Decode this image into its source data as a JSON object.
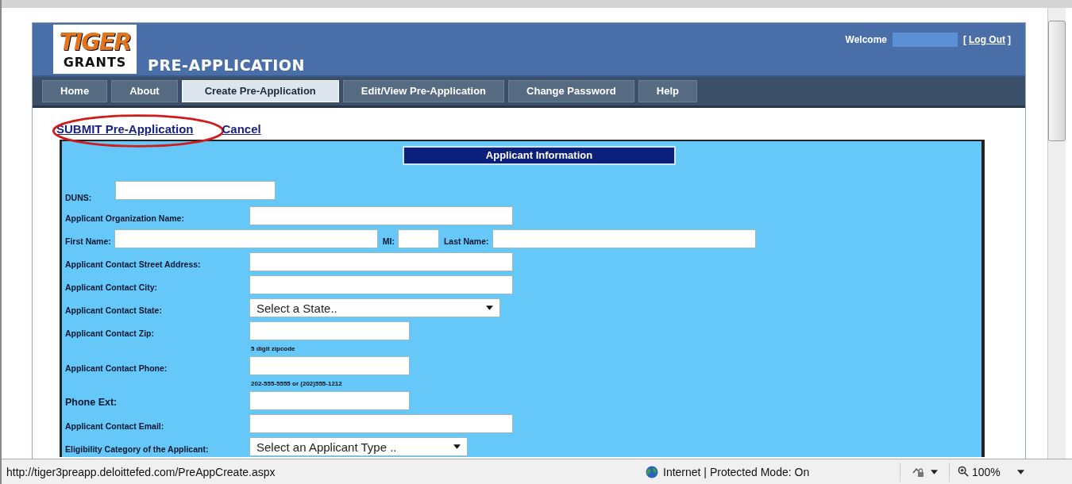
{
  "header": {
    "logo_top": "TIGER",
    "logo_bottom": "GRANTS",
    "title": "PRE-APPLICATION",
    "welcome": "Welcome",
    "user_name_hidden": true,
    "logout_open": "[",
    "logout": "Log Out",
    "logout_close": "]"
  },
  "nav": [
    {
      "label": "Home",
      "selected": false
    },
    {
      "label": "About",
      "selected": false
    },
    {
      "label": "Create Pre-Application",
      "selected": true
    },
    {
      "label": "Edit/View Pre-Application",
      "selected": false
    },
    {
      "label": "Change Password",
      "selected": false
    },
    {
      "label": "Help",
      "selected": false
    }
  ],
  "actions": [
    {
      "label": "SUBMIT Pre-Application",
      "circled": true
    },
    {
      "label": "Cancel",
      "circled": false
    }
  ],
  "form": {
    "title": "Applicant Information",
    "rows": [
      {
        "kind": "inline",
        "fields": [
          {
            "label": "DUNS:",
            "kind": "text"
          }
        ]
      },
      {
        "kind": "column",
        "fields": [
          {
            "label": "Applicant Organization Name:",
            "kind": "text"
          }
        ]
      },
      {
        "kind": "inline",
        "fields": [
          {
            "label": "First Name:",
            "kind": "text"
          },
          {
            "label": "MI:",
            "kind": "text"
          },
          {
            "label": "Last Name:",
            "kind": "text"
          }
        ]
      },
      {
        "kind": "column",
        "fields": [
          {
            "label": "Applicant Contact Street Address:",
            "kind": "text"
          }
        ]
      },
      {
        "kind": "column",
        "fields": [
          {
            "label": "Applicant Contact City:",
            "kind": "text"
          }
        ]
      },
      {
        "kind": "column",
        "fields": [
          {
            "label": "Applicant Contact State:",
            "kind": "select",
            "value": "Select a State.."
          }
        ]
      },
      {
        "kind": "column",
        "fields": [
          {
            "label": "Applicant Contact Zip:",
            "kind": "text",
            "hint": "5 digit zipcode"
          }
        ]
      },
      {
        "kind": "column",
        "fields": [
          {
            "label": "Applicant Contact Phone:",
            "kind": "text",
            "hint": "202-555-5555 or (202)555-1212"
          }
        ]
      },
      {
        "kind": "column",
        "big": true,
        "fields": [
          {
            "label": "Phone Ext:",
            "kind": "text"
          }
        ]
      },
      {
        "kind": "column",
        "fields": [
          {
            "label": "Applicant Contact Email:",
            "kind": "text"
          }
        ]
      },
      {
        "kind": "column",
        "fields": [
          {
            "label": "Eligibility Category of the Applicant:",
            "kind": "select",
            "value": "Select an Applicant Type .."
          }
        ]
      }
    ]
  },
  "status_bar": {
    "url": "http://tiger3preapp.deloittefed.com/PreAppCreate.aspx",
    "zone": "Internet | Protected Mode: On",
    "zoom": "100%"
  }
}
